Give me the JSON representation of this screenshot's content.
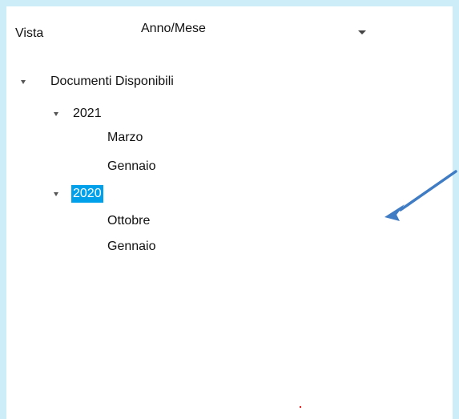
{
  "view": {
    "label": "Vista",
    "selected": "Anno/Mese"
  },
  "tree": {
    "root_label": "Documenti Disponibili",
    "years": [
      {
        "label": "2021",
        "months": [
          "Marzo",
          "Gennaio"
        ]
      },
      {
        "label": "2020",
        "months": [
          "Ottobre",
          "Gennaio"
        ]
      }
    ],
    "selected": "2020"
  },
  "colors": {
    "background": "#cdeef9",
    "selection": "#00a0ea",
    "annotation_arrow": "#3f7cc4"
  },
  "icons": {
    "dropdown": "chevron-down-icon",
    "tree_toggle": "triangle-down-icon"
  }
}
